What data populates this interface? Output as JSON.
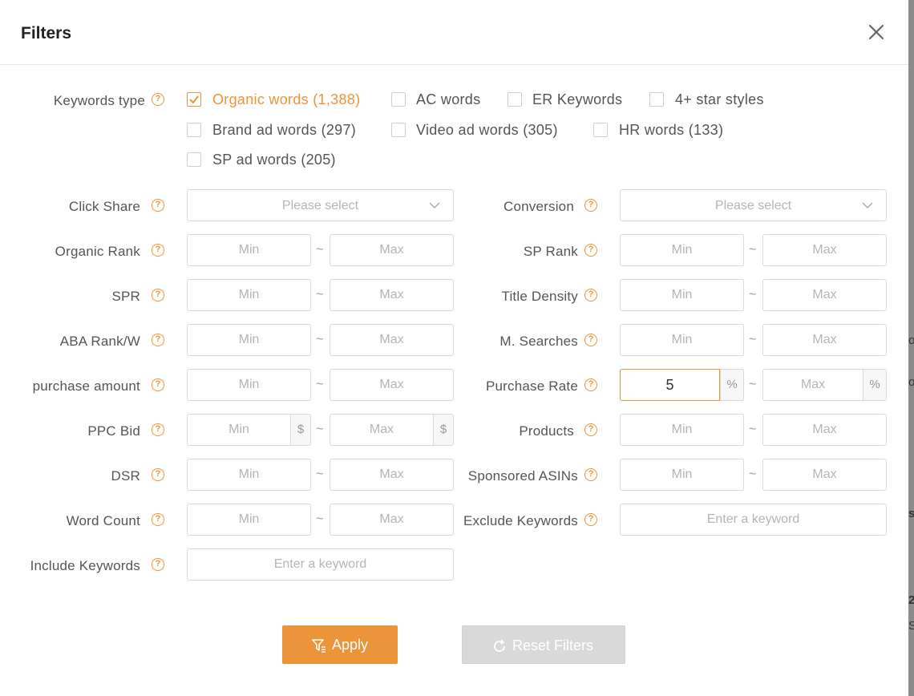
{
  "dialog": {
    "title": "Filters"
  },
  "keywords_type": {
    "label": "Keywords type",
    "options": [
      {
        "label": "Organic words (1,388)",
        "checked": true
      },
      {
        "label": "AC words",
        "checked": false
      },
      {
        "label": "ER Keywords",
        "checked": false
      },
      {
        "label": "4+ star styles",
        "checked": false
      },
      {
        "label": "Brand ad words (297)",
        "checked": false
      },
      {
        "label": "Video ad words (305)",
        "checked": false
      },
      {
        "label": "HR words (133)",
        "checked": false
      },
      {
        "label": "SP ad words (205)",
        "checked": false
      }
    ]
  },
  "fields": {
    "click_share": {
      "label": "Click Share",
      "placeholder": "Please select"
    },
    "conversion": {
      "label": "Conversion",
      "placeholder": "Please select"
    },
    "organic_rank": {
      "label": "Organic Rank",
      "min": "Min",
      "max": "Max"
    },
    "sp_rank": {
      "label": "SP Rank",
      "min": "Min",
      "max": "Max"
    },
    "spr": {
      "label": "SPR",
      "min": "Min",
      "max": "Max"
    },
    "title_density": {
      "label": "Title Density",
      "min": "Min",
      "max": "Max"
    },
    "aba_rank": {
      "label": "ABA Rank/W",
      "min": "Min",
      "max": "Max"
    },
    "m_searches": {
      "label": "M. Searches",
      "min": "Min",
      "max": "Max"
    },
    "purchase_amount": {
      "label": "purchase amount",
      "min": "Min",
      "max": "Max"
    },
    "purchase_rate": {
      "label": "Purchase Rate",
      "min_value": "5",
      "max": "Max",
      "unit": "%"
    },
    "ppc_bid": {
      "label": "PPC Bid",
      "min": "Min",
      "max": "Max",
      "unit": "$"
    },
    "products": {
      "label": "Products",
      "min": "Min",
      "max": "Max"
    },
    "dsr": {
      "label": "DSR",
      "min": "Min",
      "max": "Max"
    },
    "sponsored_asins": {
      "label": "Sponsored ASINs",
      "min": "Min",
      "max": "Max"
    },
    "word_count": {
      "label": "Word Count",
      "min": "Min",
      "max": "Max"
    },
    "exclude_keywords": {
      "label": "Exclude Keywords",
      "placeholder": "Enter a keyword"
    },
    "include_keywords": {
      "label": "Include Keywords",
      "placeholder": "Enter a keyword"
    }
  },
  "separator": "~",
  "help_glyph": "?",
  "buttons": {
    "apply": "Apply",
    "reset": "Reset Filters"
  },
  "backdrop_fragments": [
    "o",
    "o",
    "s",
    "2",
    "S"
  ],
  "colors": {
    "accent": "#ec9439",
    "disabled": "#d9d9d9"
  }
}
